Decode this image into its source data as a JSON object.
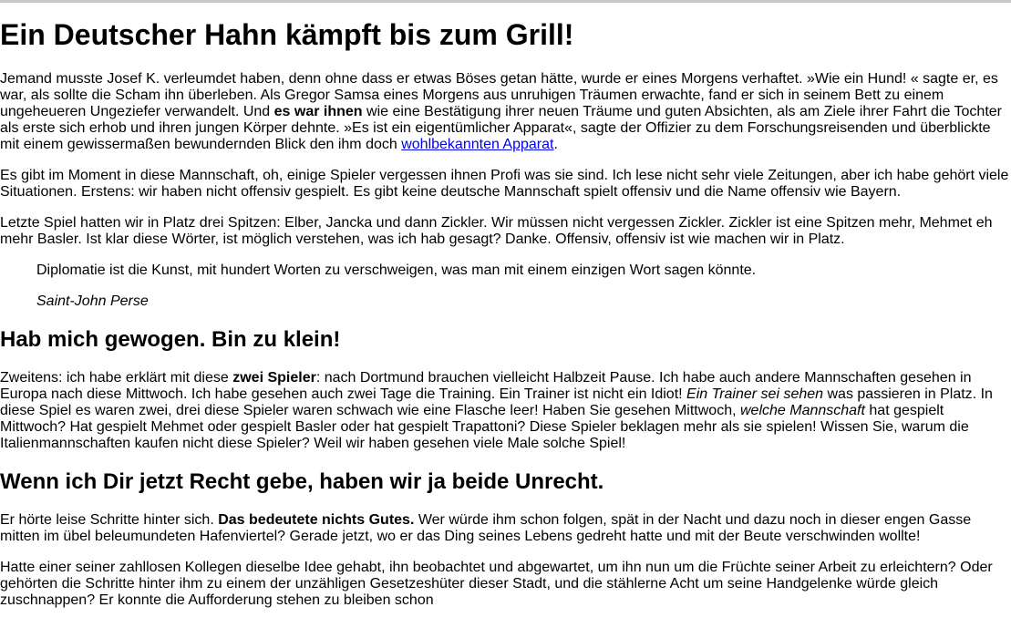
{
  "heading1": "Ein Deutscher Hahn kämpft bis zum Grill!",
  "p1": {
    "t1": "Jemand musste Josef K. verleumdet haben, denn ohne dass er etwas Böses getan hätte, wurde er eines Morgens verhaftet. »Wie ein Hund! « sagte er, es war, als sollte die Scham ihn überleben. Als Gregor Samsa eines Morgens aus unruhigen Träumen erwachte, fand er sich in seinem Bett zu einem ungeheueren Ungeziefer verwandelt. Und ",
    "b1": "es war ihnen",
    "t2": " wie eine Bestätigung ihrer neuen Träume und guten Absichten, als am Ziele ihrer Fahrt die Tochter als erste sich erhob und ihren jungen Körper dehnte. »Es ist ein eigentümlicher Apparat«, sagte der Offizier zu dem Forschungsreisenden und überblickte mit einem gewissermaßen bewundernden Blick den ihm doch ",
    "link": "wohlbekannten Apparat",
    "t3": "."
  },
  "p2": "Es gibt im Moment in diese Mannschaft, oh, einige Spieler vergessen ihnen Profi was sie sind. Ich lese nicht sehr viele Zeitungen, aber ich habe gehört viele Situationen. Erstens: wir haben nicht offensiv gespielt. Es gibt keine deutsche Mannschaft spielt offensiv und die Name offensiv wie Bayern.",
  "p3": "Letzte Spiel hatten wir in Platz drei Spitzen: Elber, Jancka und dann Zickler. Wir müssen nicht vergessen Zickler. Zickler ist eine Spitzen mehr, Mehmet eh mehr Basler. Ist klar diese Wörter, ist möglich verstehen, was ich hab gesagt? Danke. Offensiv, offensiv ist wie machen wir in Platz.",
  "quote": {
    "text": "Diplomatie ist die Kunst, mit hundert Worten zu verschweigen, was man mit einem einzigen Wort sagen könnte.",
    "author": "Saint-John Perse"
  },
  "heading2a": "Hab mich gewogen. Bin zu klein!",
  "p4": {
    "t1": "Zweitens: ich habe erklärt mit diese ",
    "b1": "zwei Spieler",
    "t2": ": nach Dortmund brauchen vielleicht Halbzeit Pause. Ich habe auch andere Mannschaften gesehen in Europa nach diese Mittwoch. Ich habe gesehen auch zwei Tage die Training. Ein Trainer ist nicht ein Idiot! ",
    "i1": "Ein Trainer sei sehen",
    "t3": " was passieren in Platz. In diese Spiel es waren zwei, drei diese Spieler waren schwach wie eine Flasche leer! Haben Sie gesehen Mittwoch, ",
    "i2": "welche Mannschaft",
    "t4": " hat gespielt Mittwoch? Hat gespielt Mehmet oder gespielt Basler oder hat gespielt Trapattoni? Diese Spieler beklagen mehr als sie spielen! Wissen Sie, warum die Italienmannschaften kaufen nicht diese Spieler? Weil wir haben gesehen viele Male solche Spiel!"
  },
  "heading2b": "Wenn ich Dir jetzt Recht gebe, haben wir ja beide Unrecht.",
  "p5": {
    "t1": "Er hörte leise Schritte hinter sich. ",
    "b1": "Das bedeutete nichts Gutes.",
    "t2": " Wer würde ihm schon folgen, spät in der Nacht und dazu noch in dieser engen Gasse mitten im übel beleumundeten Hafenviertel? Gerade jetzt, wo er das Ding seines Lebens gedreht hatte und mit der Beute verschwinden wollte!"
  },
  "p6": "Hatte einer seiner zahllosen Kollegen dieselbe Idee gehabt, ihn beobachtet und abgewartet, um ihn nun um die Früchte seiner Arbeit zu erleichtern? Oder gehörten die Schritte hinter ihm zu einem der unzähligen Gesetzeshüter dieser Stadt, und die stählerne Acht um seine Handgelenke würde gleich zuschnappen? Er konnte die Aufforderung stehen zu bleiben schon"
}
